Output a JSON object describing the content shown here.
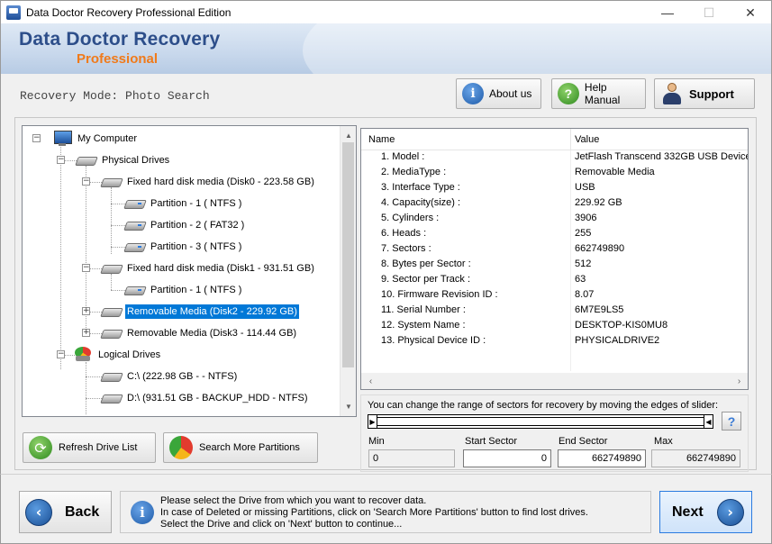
{
  "window": {
    "title": "Data Doctor Recovery Professional Edition",
    "minimize": "—",
    "maximize": "☐",
    "close": "✕"
  },
  "header": {
    "brand": "Data Doctor Recovery",
    "brand_sub": "Professional"
  },
  "modebar": {
    "mode_label": "Recovery Mode: Photo Search",
    "about_label": "About us",
    "help_label": "Help Manual",
    "support_label": "Support"
  },
  "tree": {
    "my_computer": "My Computer",
    "physical_drives": "Physical Drives",
    "disk0": "Fixed hard disk media (Disk0 - 223.58 GB)",
    "disk0_p1": "Partition - 1 ( NTFS )",
    "disk0_p2": "Partition - 2 ( FAT32 )",
    "disk0_p3": "Partition - 3 ( NTFS )",
    "disk1": "Fixed hard disk media (Disk1 - 931.51 GB)",
    "disk1_p1": "Partition - 1 ( NTFS )",
    "disk2": "Removable Media (Disk2 - 229.92 GB)",
    "disk3": "Removable Media (Disk3 - 114.44 GB)",
    "logical_drives": "Logical Drives",
    "drive_c": "C:\\ (222.98 GB -  - NTFS)",
    "drive_d": "D:\\ (931.51 GB - BACKUP_HDD - NTFS)"
  },
  "properties": {
    "col_name": "Name",
    "col_value": "Value",
    "rows": [
      {
        "name": "1. Model :",
        "value": "JetFlash Transcend 332GB USB Device"
      },
      {
        "name": "2. MediaType :",
        "value": "Removable Media"
      },
      {
        "name": "3. Interface Type :",
        "value": "USB"
      },
      {
        "name": "4. Capacity(size) :",
        "value": "229.92 GB"
      },
      {
        "name": "5. Cylinders :",
        "value": "3906"
      },
      {
        "name": "6. Heads :",
        "value": "255"
      },
      {
        "name": "7. Sectors :",
        "value": "662749890"
      },
      {
        "name": "8. Bytes per Sector :",
        "value": "512"
      },
      {
        "name": "9. Sector per Track :",
        "value": "63"
      },
      {
        "name": "10. Firmware Revision ID :",
        "value": "8.07"
      },
      {
        "name": "11. Serial Number :",
        "value": "6M7E9LS5"
      },
      {
        "name": "12. System Name :",
        "value": "DESKTOP-KIS0MU8"
      },
      {
        "name": "13. Physical Device ID :",
        "value": "PHYSICALDRIVE2"
      }
    ]
  },
  "slider": {
    "instruction": "You can change the range of sectors for recovery by moving the edges of slider:",
    "help": "?",
    "min_label": "Min",
    "start_label": "Start Sector",
    "end_label": "End Sector",
    "max_label": "Max",
    "min_value": "0",
    "start_value": "0",
    "end_value": "662749890",
    "max_value": "662749890"
  },
  "actions": {
    "refresh_label": "Refresh Drive List",
    "search_label": "Search More Partitions"
  },
  "footer": {
    "back_label": "Back",
    "next_label": "Next",
    "info_line1": "Please select the Drive from which you want to recover data.",
    "info_line2": "In case of Deleted or missing Partitions, click on 'Search More Partitions' button to find lost drives.",
    "info_line3": "Select the Drive and click on 'Next' button to continue..."
  }
}
